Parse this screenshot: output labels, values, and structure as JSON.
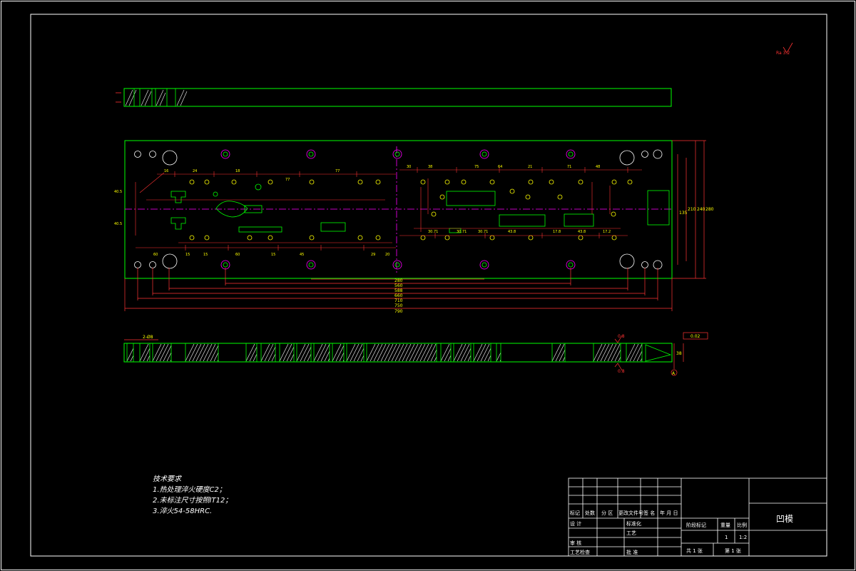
{
  "drawing": {
    "part_name": "凹模",
    "roughness_corner": "Ra 3.2",
    "roughness_side": "0.8",
    "datum_label": "A",
    "flatness_label": "0.02",
    "overall_width": "790",
    "widths": [
      "750",
      "710",
      "660",
      "588",
      "560",
      "280"
    ],
    "heights": [
      "280",
      "240",
      "210",
      "135"
    ],
    "thickness": "38"
  },
  "notes": {
    "title": "技术要求",
    "items": [
      "1.热处理淬火硬度C2；",
      "2.未标注尺寸按照IT12；",
      "3.淬火54-58HRC."
    ]
  },
  "title_block": {
    "labels": {
      "mark": "标记",
      "count": "处数",
      "zone": "分 区",
      "change_doc": "更改文件号",
      "sign": "签 名",
      "date": "年 月 日",
      "design": "设 计",
      "standardize": "标准化",
      "audit": "审 核",
      "process": "工艺",
      "craft": "工艺检查",
      "approve": "批 准",
      "stage": "阶段标记",
      "weight": "重量",
      "scale": "比例",
      "qty": "1",
      "scale_val": "1:2",
      "sheets_total": "共 1 张",
      "sheet_no": "第 1 张"
    }
  }
}
